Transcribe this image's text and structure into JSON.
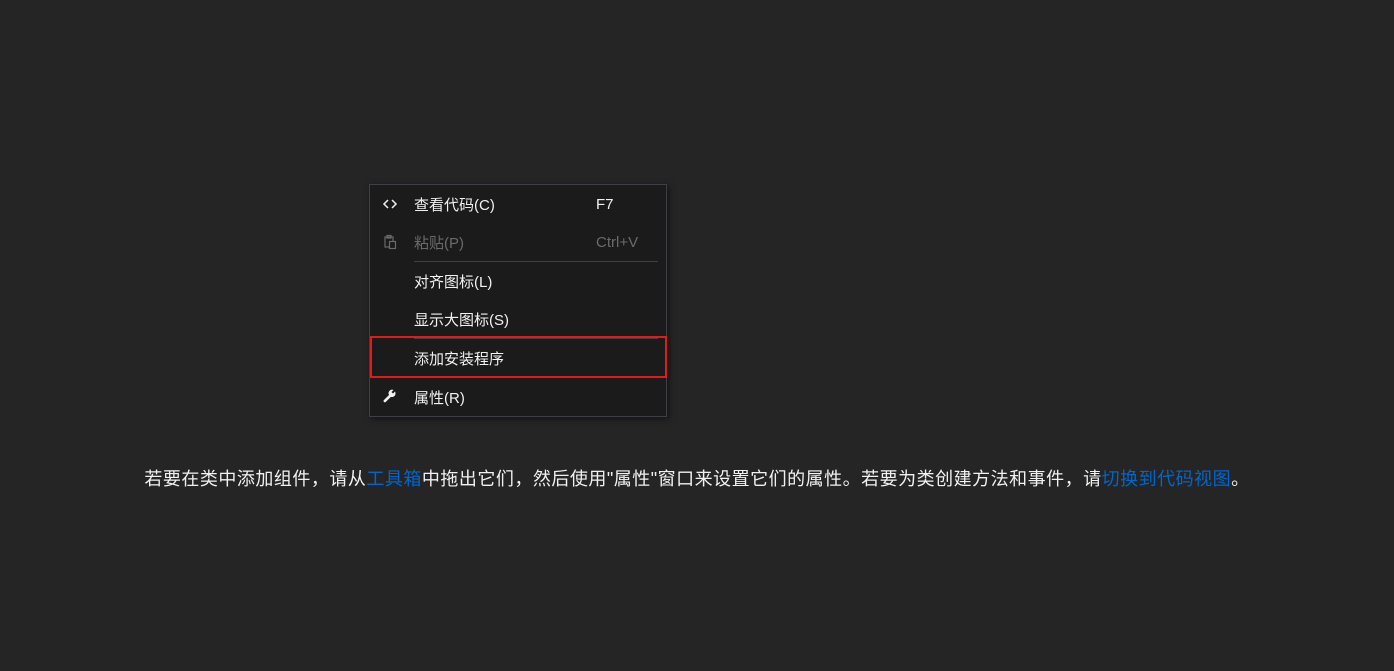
{
  "menu": {
    "view_code": {
      "label": "查看代码(C)",
      "shortcut": "F7"
    },
    "paste": {
      "label": "粘贴(P)",
      "shortcut": "Ctrl+V"
    },
    "align_icons": {
      "label": "对齐图标(L)"
    },
    "large_icons": {
      "label": "显示大图标(S)"
    },
    "add_installer": {
      "label": "添加安装程序"
    },
    "properties": {
      "label": "属性(R)"
    }
  },
  "hint": {
    "part1": "若要在类中添加组件，请从",
    "link1": "工具箱",
    "part2": "中拖出它们，然后使用\"属性\"窗口来设置它们的属性。若要为类创建方法和事件，请",
    "link2": "切换到代码视图",
    "part3": "。"
  }
}
